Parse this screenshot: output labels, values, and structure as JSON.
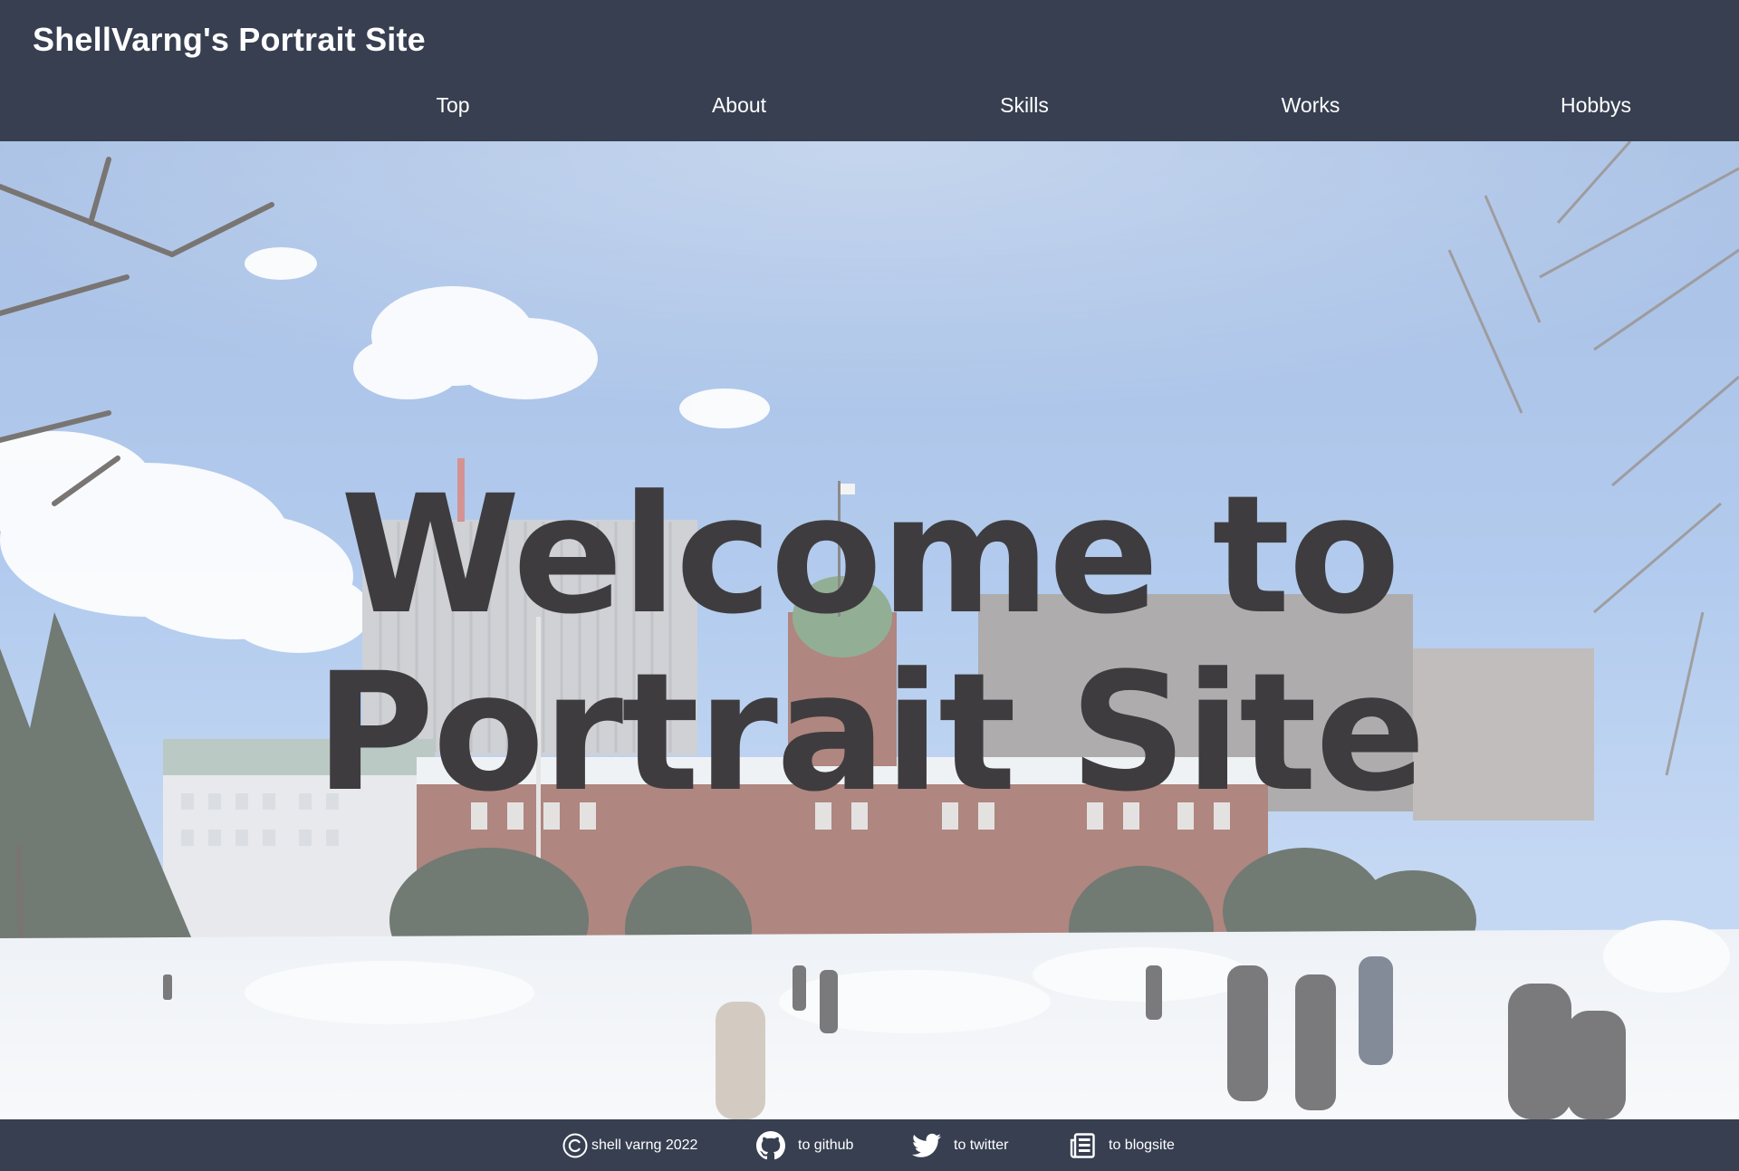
{
  "header": {
    "site_title": "ShellVarng's Portrait Site",
    "background_color": "#373f51",
    "nav": [
      {
        "label": "Top"
      },
      {
        "label": "About"
      },
      {
        "label": "Skills"
      },
      {
        "label": "Works"
      },
      {
        "label": "Hobbys"
      }
    ]
  },
  "hero": {
    "title_line1": "Welcome to",
    "title_line2": "Portrait Site",
    "title_color": "#3f3c3f"
  },
  "footer": {
    "copyright_text": "shell varng 2022",
    "copyright_icon": "copyright-icon",
    "github_text": "to github",
    "github_icon": "github-icon",
    "twitter_text": "to twitter",
    "twitter_icon": "twitter-icon",
    "blog_text": "to blogsite",
    "blog_icon": "newspaper-icon",
    "background_color": "#373f51"
  }
}
